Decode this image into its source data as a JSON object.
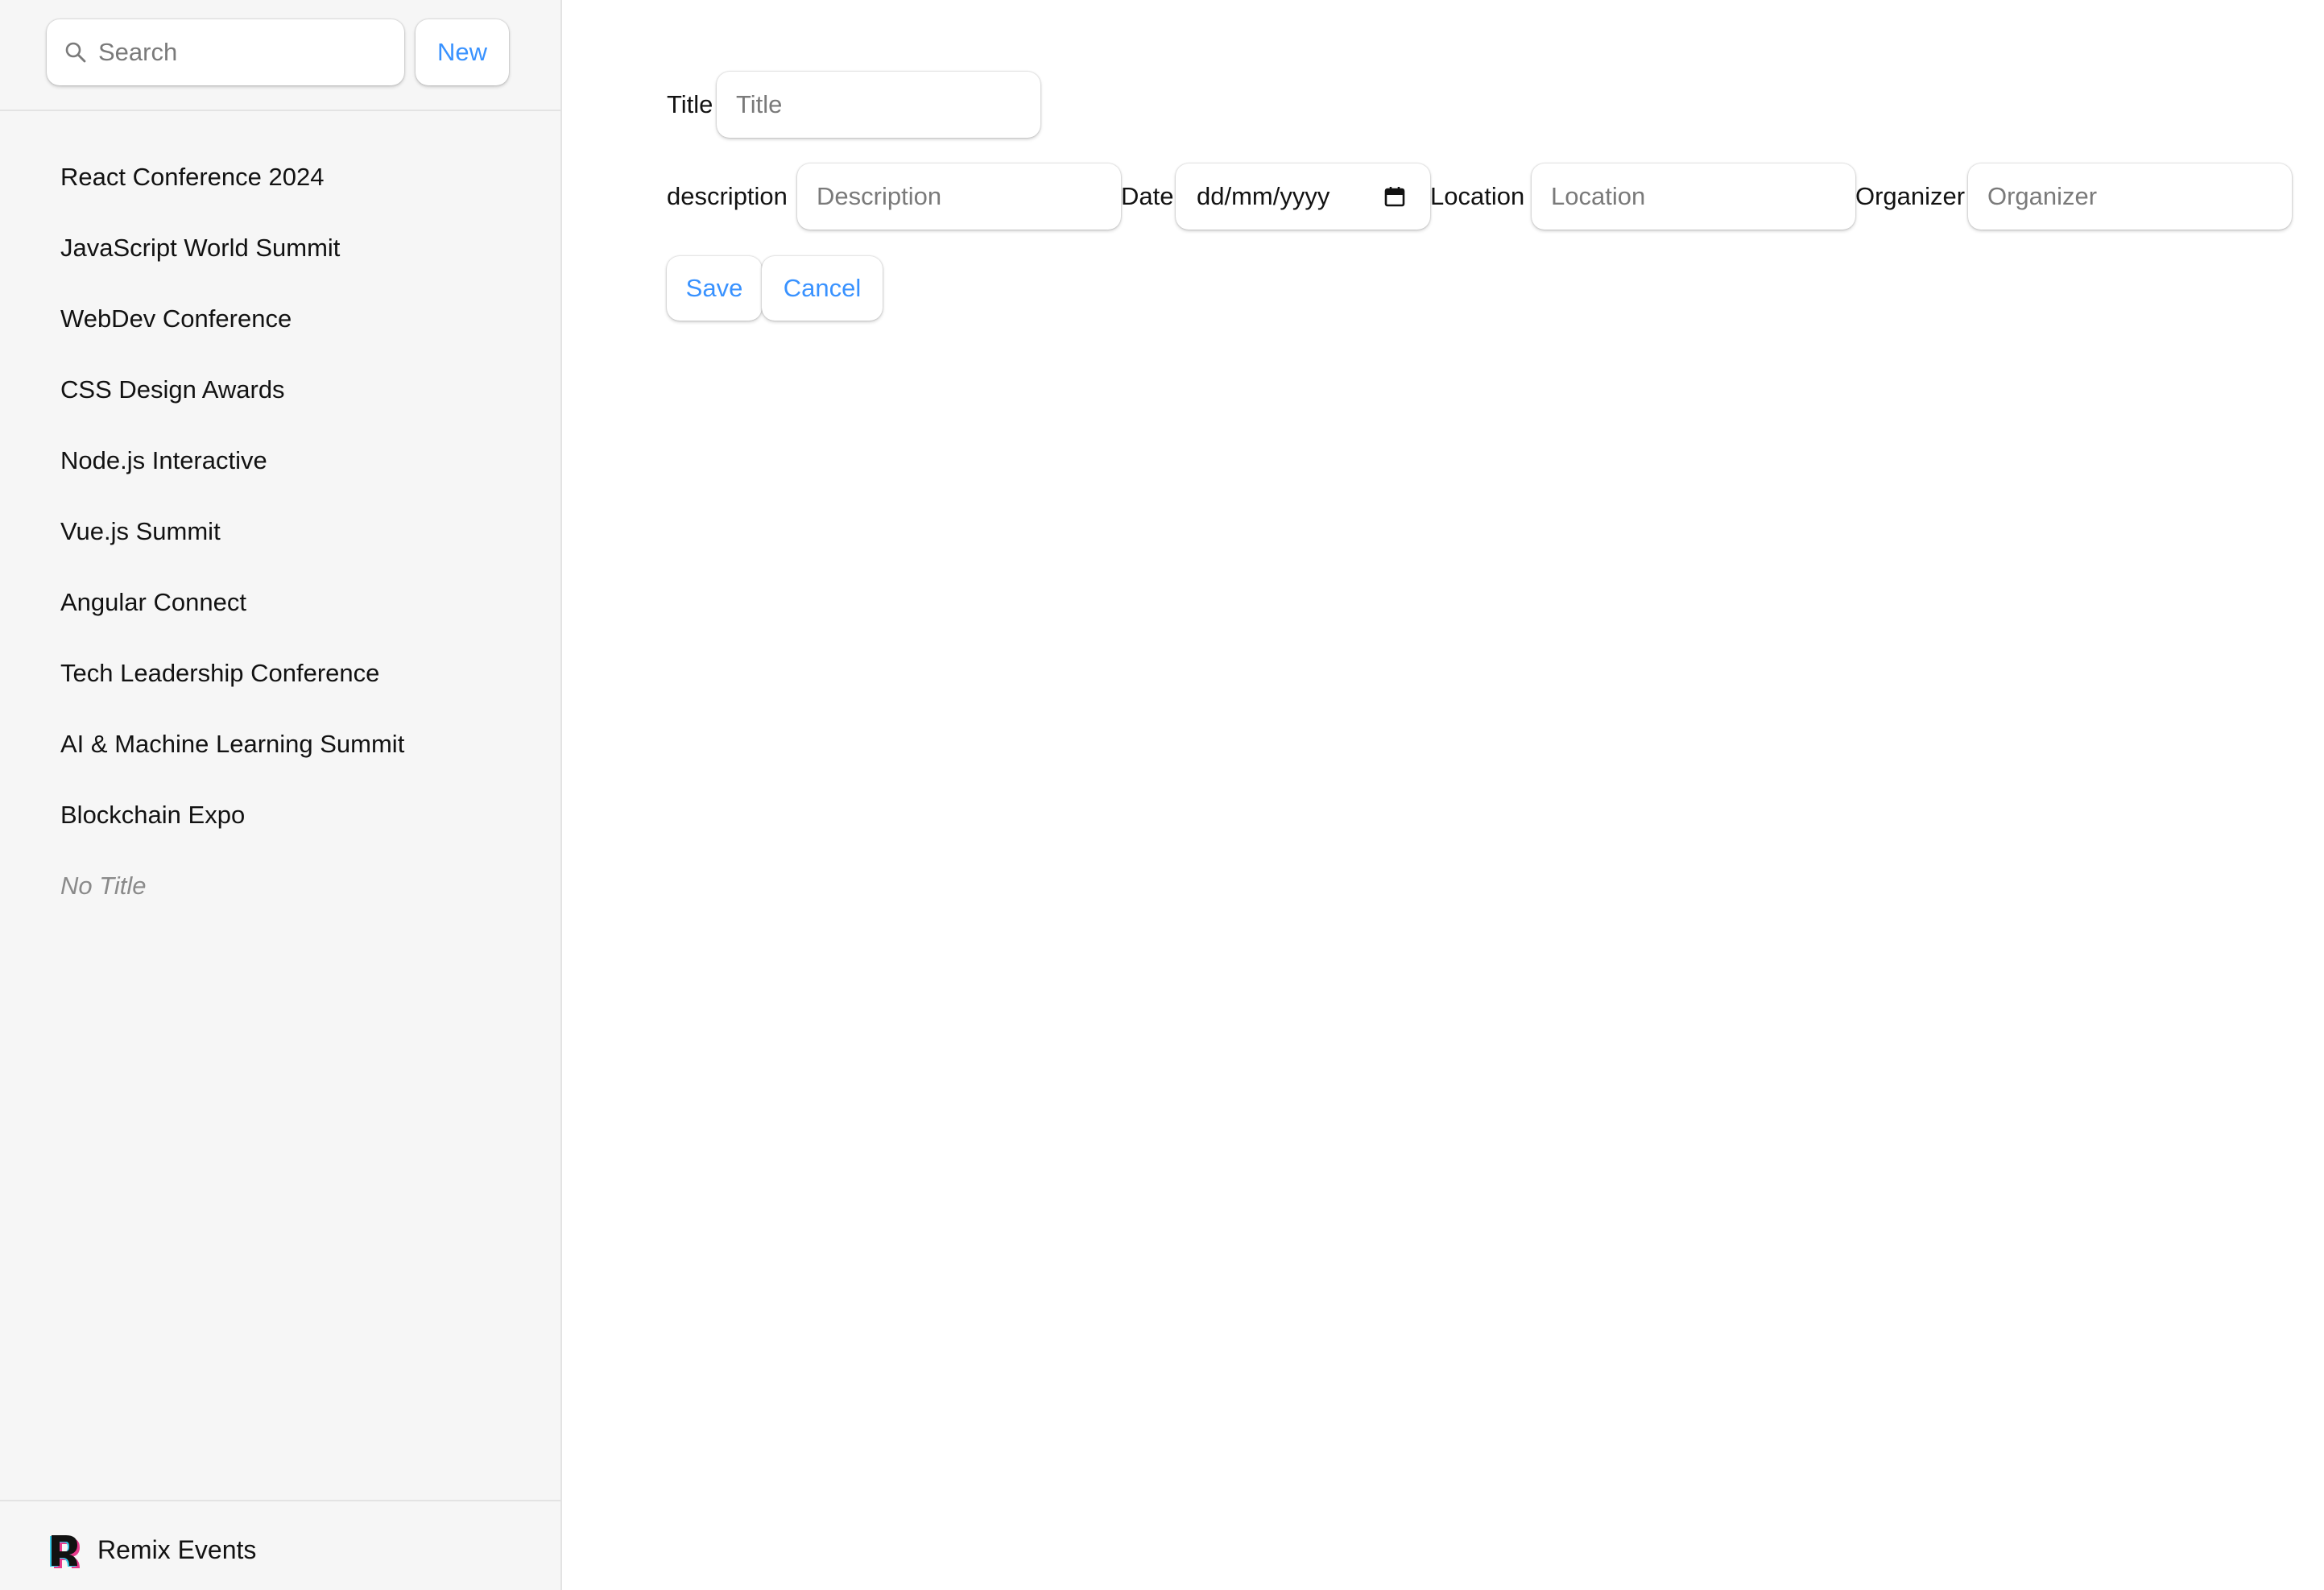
{
  "sidebar": {
    "search": {
      "placeholder": "Search",
      "value": ""
    },
    "new_label": "New",
    "items": [
      {
        "label": "React Conference 2024"
      },
      {
        "label": "JavaScript World Summit"
      },
      {
        "label": "WebDev Conference"
      },
      {
        "label": "CSS Design Awards"
      },
      {
        "label": "Node.js Interactive"
      },
      {
        "label": "Vue.js Summit"
      },
      {
        "label": "Angular Connect"
      },
      {
        "label": "Tech Leadership Conference"
      },
      {
        "label": "AI & Machine Learning Summit"
      },
      {
        "label": "Blockchain Expo"
      },
      {
        "label": "No Title"
      }
    ],
    "footer": {
      "brand": "Remix Events",
      "logo_icon": "remix-logo-icon"
    }
  },
  "form": {
    "title": {
      "label": "Title",
      "placeholder": "Title",
      "value": ""
    },
    "description": {
      "label": "description",
      "placeholder": "Description",
      "value": ""
    },
    "date": {
      "label": "Date",
      "value": "dd/mm/yyyy",
      "icon": "calendar-icon"
    },
    "location": {
      "label": "Location",
      "placeholder": "Location",
      "value": ""
    },
    "organizer": {
      "label": "Organizer",
      "placeholder": "Organizer",
      "value": ""
    },
    "save_label": "Save",
    "cancel_label": "Cancel"
  },
  "colors": {
    "accent": "#3992ff",
    "sidebar_bg": "#f6f6f6",
    "border": "#e3e3e3",
    "text": "#121212",
    "muted": "#8a8a8a"
  }
}
